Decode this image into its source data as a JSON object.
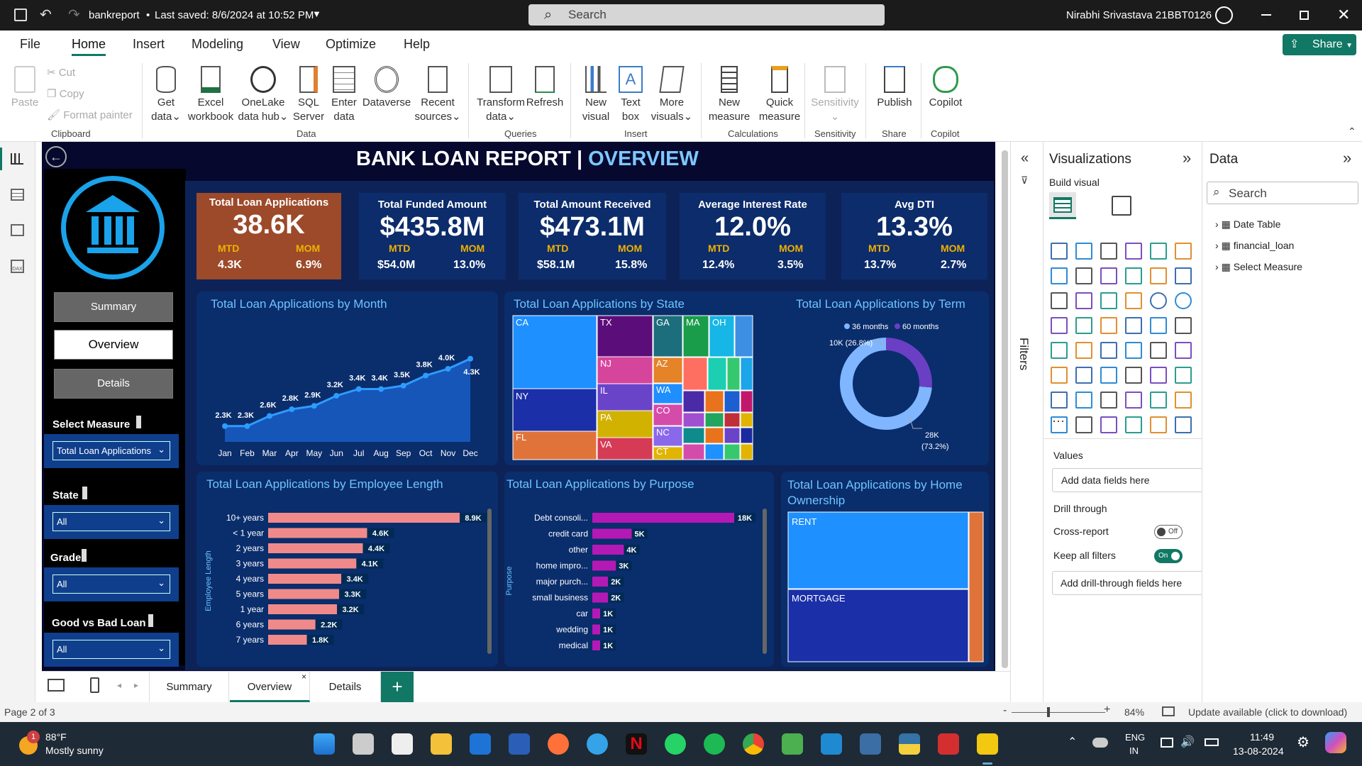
{
  "titlebar": {
    "filename": "bankreport",
    "saved": "Last saved: 8/6/2024 at 10:52 PM",
    "search_placeholder": "Search",
    "user": "Nirabhi Srivastava 21BBT0126"
  },
  "menu": [
    "File",
    "Home",
    "Insert",
    "Modeling",
    "View",
    "Optimize",
    "Help"
  ],
  "share_label": "Share",
  "ribbon": {
    "clipboard": {
      "paste": "Paste",
      "cut": "Cut",
      "copy": "Copy",
      "format_painter": "Format painter",
      "group": "Clipboard"
    },
    "data": {
      "get_data": [
        "Get",
        "data"
      ],
      "excel": [
        "Excel",
        "workbook"
      ],
      "onelake": [
        "OneLake",
        "data hub"
      ],
      "sql": [
        "SQL",
        "Server"
      ],
      "enter": [
        "Enter",
        "data"
      ],
      "dataverse": "Dataverse",
      "recent": [
        "Recent",
        "sources"
      ],
      "group": "Data"
    },
    "queries": {
      "transform": [
        "Transform",
        "data"
      ],
      "refresh": "Refresh",
      "group": "Queries"
    },
    "insert": {
      "new_visual": [
        "New",
        "visual"
      ],
      "text_box": [
        "Text",
        "box"
      ],
      "more_visuals": [
        "More",
        "visuals"
      ],
      "group": "Insert"
    },
    "calculations": {
      "new_measure": [
        "New",
        "measure"
      ],
      "quick_measure": [
        "Quick",
        "measure"
      ],
      "group": "Calculations"
    },
    "sensitivity": {
      "label": "Sensitivity",
      "group": "Sensitivity"
    },
    "share": {
      "publish": "Publish",
      "group": "Share"
    },
    "copilot": {
      "label": "Copilot",
      "group": "Copilot"
    }
  },
  "report": {
    "title_main": "BANK LOAN REPORT | ",
    "title_sub": "OVERVIEW",
    "nav": {
      "summary": "Summary",
      "overview": "Overview",
      "details": "Details"
    },
    "slicers": [
      {
        "label": "Select Measure",
        "value": "Total Loan Applications"
      },
      {
        "label": "State",
        "value": "All"
      },
      {
        "label": "Grade",
        "value": "All"
      },
      {
        "label": "Good vs Bad Loan",
        "value": "All"
      }
    ],
    "kpis": [
      {
        "title": "Total Loan Applications",
        "value": "38.6K",
        "mtd_label": "MTD",
        "mom_label": "MOM",
        "mtd": "4.3K",
        "mom": "6.9%"
      },
      {
        "title": "Total Funded Amount",
        "value": "$435.8M",
        "mtd_label": "MTD",
        "mom_label": "MOM",
        "mtd": "$54.0M",
        "mom": "13.0%"
      },
      {
        "title": "Total Amount Received",
        "value": "$473.1M",
        "mtd_label": "MTD",
        "mom_label": "MOM",
        "mtd": "$58.1M",
        "mom": "15.8%"
      },
      {
        "title": "Average Interest Rate",
        "value": "12.0%",
        "mtd_label": "MTD",
        "mom_label": "MOM",
        "mtd": "12.4%",
        "mom": "3.5%"
      },
      {
        "title": "Avg DTI",
        "value": "13.3%",
        "mtd_label": "MTD",
        "mom_label": "MOM",
        "mtd": "13.7%",
        "mom": "2.7%"
      }
    ]
  },
  "chart_data": [
    {
      "type": "area",
      "title": "Total Loan Applications by Month",
      "categories": [
        "Jan",
        "Feb",
        "Mar",
        "Apr",
        "May",
        "Jun",
        "Jul",
        "Aug",
        "Sep",
        "Oct",
        "Nov",
        "Dec"
      ],
      "values": [
        2300,
        2300,
        2600,
        2800,
        2900,
        3200,
        3400,
        3400,
        3500,
        3800,
        4000,
        4300
      ],
      "labels": [
        "2.3K",
        "2.3K",
        "2.6K",
        "2.8K",
        "2.9K",
        "3.2K",
        "3.4K",
        "3.4K",
        "3.5K",
        "3.8K",
        "4.0K",
        "4.3K"
      ]
    },
    {
      "type": "treemap",
      "title": "Total Loan Applications by State",
      "categories": [
        "CA",
        "NY",
        "FL",
        "TX",
        "NJ",
        "IL",
        "PA",
        "VA",
        "GA",
        "MA",
        "OH",
        "AZ",
        "WA",
        "CO",
        "NC",
        "CT"
      ]
    },
    {
      "type": "pie",
      "title": "Total Loan Applications by Term",
      "legend": [
        "36 months",
        "60 months"
      ],
      "values": [
        28000,
        10000
      ],
      "labels": [
        "28K (73.2%)",
        "10K (26.8%)"
      ]
    },
    {
      "type": "bar",
      "title": "Total Loan Applications by Employee Length",
      "ylabel": "Employee Length",
      "categories": [
        "10+ years",
        "< 1 year",
        "2 years",
        "3 years",
        "4 years",
        "5 years",
        "1 year",
        "6 years",
        "7 years"
      ],
      "values": [
        8900,
        4600,
        4400,
        4100,
        3400,
        3300,
        3200,
        2200,
        1800
      ],
      "labels": [
        "8.9K",
        "4.6K",
        "4.4K",
        "4.1K",
        "3.4K",
        "3.3K",
        "3.2K",
        "2.2K",
        "1.8K"
      ]
    },
    {
      "type": "bar",
      "title": "Total Loan Applications by Purpose",
      "ylabel": "Purpose",
      "categories": [
        "Debt consoli...",
        "credit card",
        "other",
        "home impro...",
        "major purch...",
        "small business",
        "car",
        "wedding",
        "medical"
      ],
      "values": [
        18000,
        5000,
        4000,
        3000,
        2000,
        2000,
        1000,
        1000,
        1000
      ],
      "labels": [
        "18K",
        "5K",
        "4K",
        "3K",
        "2K",
        "2K",
        "1K",
        "1K",
        "1K"
      ]
    },
    {
      "type": "treemap",
      "title": "Total Loan Applications by Home Ownership",
      "categories": [
        "RENT",
        "MORTGAGE"
      ]
    }
  ],
  "panes": {
    "filters": "Filters",
    "visualizations": "Visualizations",
    "build_visual": "Build visual",
    "values": "Values",
    "add_data_fields": "Add data fields here",
    "drill_through": "Drill through",
    "cross_report": "Cross-report",
    "cross_report_state": "Off",
    "keep_all_filters": "Keep all filters",
    "keep_state": "On",
    "add_drill": "Add drill-through fields here",
    "data": "Data",
    "data_search": "Search",
    "tables": [
      "Date Table",
      "financial_loan",
      "Select Measure"
    ]
  },
  "tabs": [
    "Summary",
    "Overview",
    "Details"
  ],
  "status": {
    "page": "Page 2 of 3",
    "zoom": "84%",
    "update": "Update available (click to download)"
  },
  "taskbar": {
    "temp": "88°F",
    "weather": "Mostly sunny",
    "badge": "1",
    "lang1": "ENG",
    "lang2": "IN",
    "time": "11:49",
    "date": "13-08-2024"
  }
}
